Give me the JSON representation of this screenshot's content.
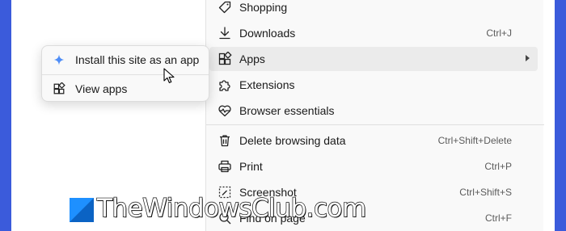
{
  "menu": {
    "items": [
      {
        "label": "Shopping",
        "shortcut": "",
        "icon": "tag-icon"
      },
      {
        "label": "Downloads",
        "shortcut": "Ctrl+J",
        "icon": "download-icon"
      },
      {
        "label": "Apps",
        "shortcut": "",
        "icon": "apps-icon",
        "has_submenu": true,
        "highlighted": true
      },
      {
        "label": "Extensions",
        "shortcut": "",
        "icon": "puzzle-icon"
      },
      {
        "label": "Browser essentials",
        "shortcut": "",
        "icon": "heartbeat-icon"
      },
      {
        "label": "Delete browsing data",
        "shortcut": "Ctrl+Shift+Delete",
        "icon": "trash-icon"
      },
      {
        "label": "Print",
        "shortcut": "Ctrl+P",
        "icon": "printer-icon"
      },
      {
        "label": "Screenshot",
        "shortcut": "Ctrl+Shift+S",
        "icon": "screenshot-icon"
      },
      {
        "label": "Find on page",
        "shortcut": "Ctrl+F",
        "icon": "find-icon"
      }
    ]
  },
  "submenu": {
    "items": [
      {
        "label": "Install this site as an app",
        "icon": "sparkle-icon"
      },
      {
        "label": "View apps",
        "icon": "apps-icon"
      }
    ]
  },
  "watermark": {
    "text": "TheWindowsClub.com"
  },
  "colors": {
    "side_bars": "#3b5bdb",
    "menu_background": "#f9f9f9",
    "hover_background": "#ebebeb",
    "sparkle_accent": "#4f8ef7"
  }
}
